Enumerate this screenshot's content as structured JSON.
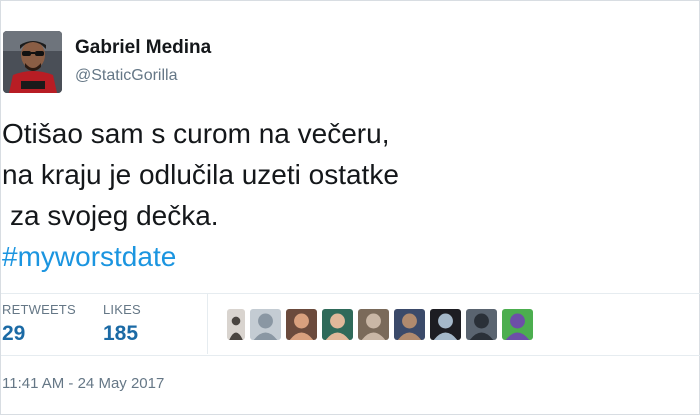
{
  "user": {
    "display_name": "Gabriel Medina",
    "handle": "@StaticGorilla",
    "avatar_icon": "user-avatar-photo"
  },
  "tweet": {
    "lines": [
      "Otišao sam s curom na večeru,",
      "na kraju je odlučila uzeti ostatke",
      "za svojeg dečka."
    ],
    "hashtag": "#myworstdate"
  },
  "stats": {
    "retweets_label": "RETWEETS",
    "retweets_count": "29",
    "likes_label": "LIKES",
    "likes_count": "185"
  },
  "likers": [
    {
      "name": "liker-avatar-1",
      "colors": [
        "#d9d4cf",
        "#4a4540"
      ]
    },
    {
      "name": "liker-avatar-2",
      "colors": [
        "#c4ccd3",
        "#8a97a3"
      ]
    },
    {
      "name": "liker-avatar-3",
      "colors": [
        "#6b4a3c",
        "#d9a07e"
      ]
    },
    {
      "name": "liker-avatar-4",
      "colors": [
        "#2f6a5a",
        "#e0b89a"
      ]
    },
    {
      "name": "liker-avatar-5",
      "colors": [
        "#7a6a5a",
        "#c9b7a6"
      ]
    },
    {
      "name": "liker-avatar-6",
      "colors": [
        "#3b4a6a",
        "#b08a6e"
      ]
    },
    {
      "name": "liker-avatar-7",
      "colors": [
        "#1d1d22",
        "#a5b8c9"
      ]
    },
    {
      "name": "liker-avatar-8",
      "colors": [
        "#5a6470",
        "#2a3038"
      ]
    },
    {
      "name": "liker-avatar-9",
      "colors": [
        "#4cae4f",
        "#6d4fa8"
      ]
    }
  ],
  "timestamp": "11:41 AM - 24 May 2017",
  "colors": {
    "hashtag": "#1b95e0",
    "count": "#1b6aa5",
    "secondary_text": "#657786"
  }
}
